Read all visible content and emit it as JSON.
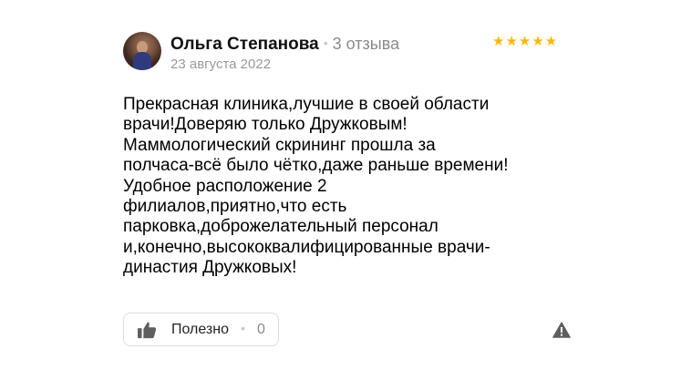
{
  "author": {
    "name": "Ольга Степанова",
    "separator": "•",
    "reviews_count": "3 отзыва",
    "date": "23 августа 2022"
  },
  "rating": {
    "stars": 5,
    "max_stars": 5,
    "stars_text": "★★★★★",
    "color": "#ffb800"
  },
  "review": {
    "text": "Прекрасная клиника,лучшие в своей области\nврачи!Доверяю только Дружковым!\nМаммологический скрининг прошла за\nполчаса-всё было чётко,даже раньше времени!\nУдобное расположение 2\nфилиалов,приятно,что есть\nпарковка,доброжелательный персонал\nи,конечно,высококвалифицированные врачи-\nдинастия Дружковых!"
  },
  "actions": {
    "useful_label": "Полезно",
    "useful_separator": "•",
    "useful_count": "0"
  },
  "icons": {
    "thumb": "thumbs-up-icon",
    "report": "warning-icon"
  }
}
